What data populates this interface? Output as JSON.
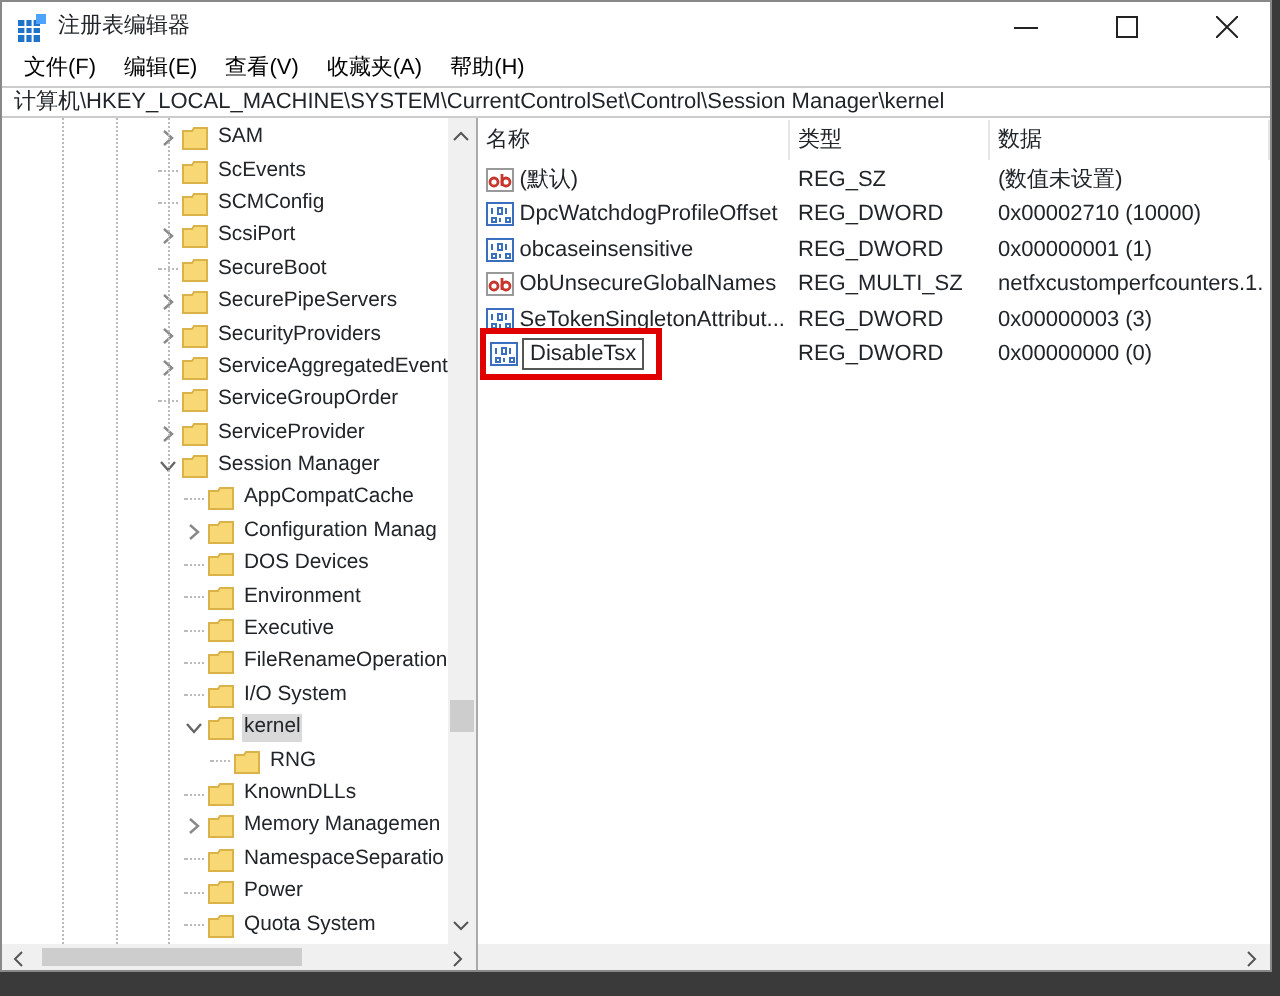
{
  "window": {
    "title": "注册表编辑器"
  },
  "menu": [
    "文件(F)",
    "编辑(E)",
    "查看(V)",
    "收藏夹(A)",
    "帮助(H)"
  ],
  "address": "计算机\\HKEY_LOCAL_MACHINE\\SYSTEM\\CurrentControlSet\\Control\\Session Manager\\kernel",
  "tree": [
    {
      "label": "SAM",
      "has_children": true,
      "expanded": false,
      "selected": false
    },
    {
      "label": "ScEvents",
      "has_children": false,
      "selected": false
    },
    {
      "label": "SCMConfig",
      "has_children": false,
      "selected": false
    },
    {
      "label": "ScsiPort",
      "has_children": true,
      "expanded": false,
      "selected": false
    },
    {
      "label": "SecureBoot",
      "has_children": false,
      "selected": false
    },
    {
      "label": "SecurePipeServers",
      "has_children": true,
      "expanded": false,
      "selected": false
    },
    {
      "label": "SecurityProviders",
      "has_children": true,
      "expanded": false,
      "selected": false
    },
    {
      "label": "ServiceAggregatedEvent",
      "has_children": true,
      "expanded": false,
      "selected": false
    },
    {
      "label": "ServiceGroupOrder",
      "has_children": false,
      "selected": false
    },
    {
      "label": "ServiceProvider",
      "has_children": true,
      "expanded": false,
      "selected": false
    },
    {
      "label": "Session Manager",
      "has_children": true,
      "expanded": true,
      "selected": false,
      "children": [
        {
          "label": "AppCompatCache",
          "has_children": false,
          "selected": false
        },
        {
          "label": "Configuration Manag",
          "has_children": true,
          "expanded": false,
          "selected": false
        },
        {
          "label": "DOS Devices",
          "has_children": false,
          "selected": false
        },
        {
          "label": "Environment",
          "has_children": false,
          "selected": false
        },
        {
          "label": "Executive",
          "has_children": false,
          "selected": false
        },
        {
          "label": "FileRenameOperation",
          "has_children": false,
          "selected": false
        },
        {
          "label": "I/O System",
          "has_children": false,
          "selected": false
        },
        {
          "label": "kernel",
          "has_children": true,
          "expanded": true,
          "selected": true,
          "children": [
            {
              "label": "RNG",
              "has_children": false,
              "selected": false
            }
          ]
        },
        {
          "label": "KnownDLLs",
          "has_children": false,
          "selected": false
        },
        {
          "label": "Memory Managemen",
          "has_children": true,
          "expanded": false,
          "selected": false
        },
        {
          "label": "NamespaceSeparatio",
          "has_children": false,
          "selected": false
        },
        {
          "label": "Power",
          "has_children": false,
          "selected": false
        },
        {
          "label": "Quota System",
          "has_children": false,
          "selected": false
        }
      ]
    }
  ],
  "values": {
    "columns": [
      "名称",
      "类型",
      "数据"
    ],
    "rows": [
      {
        "kind": "string",
        "name": "(默认)",
        "type": "REG_SZ",
        "data": "(数值未设置)",
        "editing": false
      },
      {
        "kind": "binary",
        "name": "DpcWatchdogProfileOffset",
        "type": "REG_DWORD",
        "data": "0x00002710 (10000)",
        "editing": false
      },
      {
        "kind": "binary",
        "name": "obcaseinsensitive",
        "type": "REG_DWORD",
        "data": "0x00000001 (1)",
        "editing": false
      },
      {
        "kind": "string",
        "name": "ObUnsecureGlobalNames",
        "type": "REG_MULTI_SZ",
        "data": "netfxcustomperfcounters.1.",
        "editing": false
      },
      {
        "kind": "binary",
        "name": "SeTokenSingletonAttribut...",
        "type": "REG_DWORD",
        "data": "0x00000003 (3)",
        "editing": false
      },
      {
        "kind": "binary",
        "name": "DisableTsx",
        "type": "REG_DWORD",
        "data": "0x00000000 (0)",
        "editing": true
      }
    ]
  }
}
